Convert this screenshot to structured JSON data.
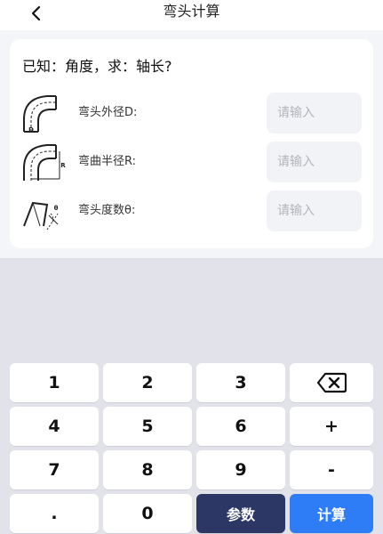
{
  "header": {
    "title": "弯头计算",
    "back_icon": "chevron-left-icon"
  },
  "card": {
    "question": "已知：角度，求：轴长?",
    "rows": [
      {
        "label": "弯头外径D:",
        "placeholder": "请输入",
        "value": "",
        "icon": "elbow-diameter-icon",
        "pic_letter": "D"
      },
      {
        "label": "弯曲半径R:",
        "placeholder": "请输入",
        "value": "",
        "icon": "elbow-radius-icon",
        "pic_letter": "R"
      },
      {
        "label": "弯头度数θ:",
        "placeholder": "请输入",
        "value": "",
        "icon": "elbow-angle-icon",
        "pic_letter": "θ"
      }
    ]
  },
  "keyboard": {
    "rows": [
      [
        "1",
        "2",
        "3",
        "backspace"
      ],
      [
        "4",
        "5",
        "6",
        "+"
      ],
      [
        "7",
        "8",
        "9",
        "-"
      ],
      [
        ".",
        "0",
        "参数",
        "计算"
      ]
    ],
    "backspace_icon": "backspace-icon",
    "colors": {
      "params": "#2c3766",
      "calc": "#2f7df6",
      "background": "#e1e2ea"
    }
  }
}
